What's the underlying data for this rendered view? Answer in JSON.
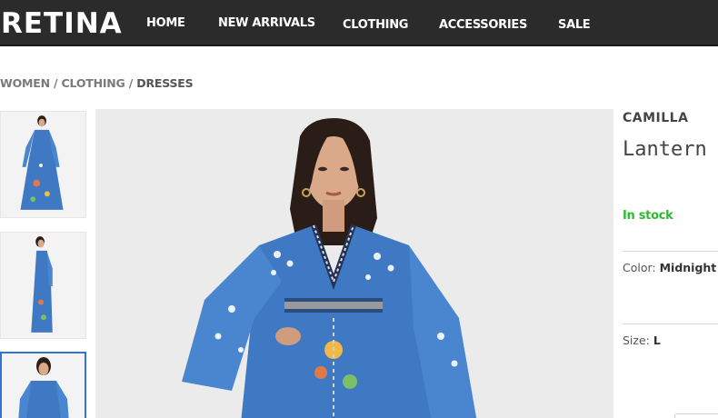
{
  "header": {
    "logo": "RETINA",
    "nav": [
      "HOME",
      "NEW ARRIVALS",
      "CLOTHING",
      "ACCESSORIES",
      "SALE"
    ]
  },
  "breadcrumb": {
    "items": [
      "WOMEN",
      "CLOTHING",
      "DRESSES"
    ],
    "separator": " / "
  },
  "product": {
    "brand": "CAMILLA",
    "title": "Lantern S",
    "stock": "In stock",
    "color_label": "Color: ",
    "color_value": "Midnight I",
    "size_label": "Size: ",
    "size_value": "L"
  },
  "colors": {
    "topbar": "#2b2b2b",
    "stock": "#2dbb2d",
    "selected_thumb_border": "#2f74d6",
    "dress_blue": "#3f79c4"
  }
}
